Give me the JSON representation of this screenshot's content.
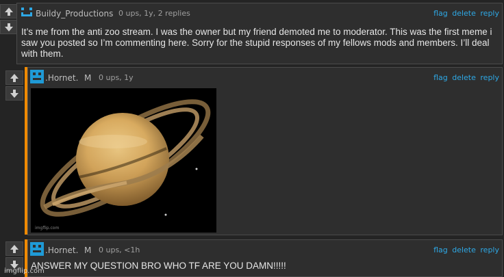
{
  "comments": [
    {
      "username": "Buildy_Productions",
      "meta": "0 ups, 1y, 2 replies",
      "actions": [
        "flag",
        "delete",
        "reply"
      ],
      "text": "It’s me from the anti zoo stream. I was the owner but my friend demoted me to moderator. This was the first meme i saw you posted so I’m commenting here. Sorry for the stupid responses of my fellows mods and members. I’ll deal with them.",
      "avatar_color": "#2ea8e5"
    },
    {
      "username": ".Hornet.",
      "badge": "M",
      "meta": "0 ups, 1y",
      "actions": [
        "flag",
        "delete",
        "reply"
      ],
      "image_caption": "imgflip.com",
      "avatar_color": "#1f9ad6"
    },
    {
      "username": ".Hornet.",
      "badge": "M",
      "meta": "0 ups, <1h",
      "actions": [
        "flag",
        "delete",
        "reply"
      ],
      "text": "ANSWER MY QUESTION BRO WHO TF ARE YOU DAMN!!!!!",
      "avatar_color": "#1f9ad6"
    }
  ],
  "watermark": "imgflip.com",
  "colors": {
    "accent": "#2ea8e5",
    "reply_bar": "#f08a00",
    "background": "#242424",
    "card": "#2e2e2e"
  },
  "icons": {
    "upvote": "up-arrow-icon",
    "downvote": "down-arrow-icon"
  }
}
